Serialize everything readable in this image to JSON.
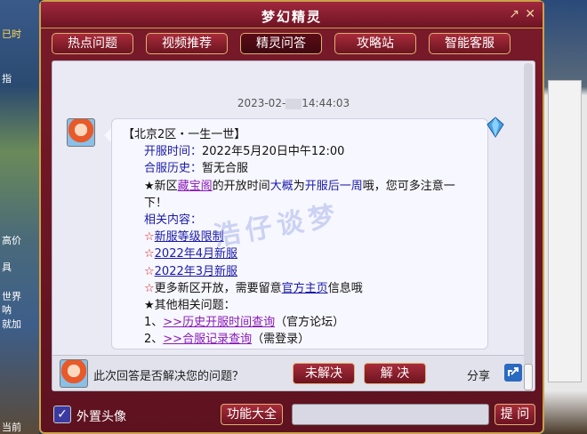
{
  "window": {
    "title": "梦幻精灵"
  },
  "nav": [
    "热点问题",
    "视频推荐",
    "精灵问答",
    "攻略站",
    "智能客服"
  ],
  "chat": {
    "timestamp_prefix": "2023-02-",
    "timestamp_suffix": "14:44:03",
    "answer": {
      "heading": "【北京2区・一生一世】",
      "open_label": "开服时间：",
      "open_value": "2022年5月20日中午12:00",
      "merge_label": "合服历史：",
      "merge_value": "暂无合服",
      "tip_a": "★新区",
      "tip_link": "藏宝阁",
      "tip_b": "的开放时间",
      "tip_c": "大概",
      "tip_d": "为",
      "tip_e": "开服后一周",
      "tip_f": "哦，您可多注意一下！",
      "related_label": "相关内容：",
      "related": [
        "新服等级限制",
        "2022年4月新服",
        "2022年3月新服"
      ],
      "more_a": "更多新区开放，需要留意",
      "more_link": "官方主页",
      "more_b": "信息哦",
      "other_label": "★其他相关问题：",
      "q1_num": "1、",
      "q1_link": ">>历史开服时间查询",
      "q1_note": "（官方论坛）",
      "q2_num": "2、",
      "q2_link": ">>合服记录查询",
      "q2_note": "（需登录）"
    },
    "watermark": "浩仔谈梦"
  },
  "feedback": {
    "question": "此次回答是否解决您的问题？",
    "unresolved": "未解决",
    "resolved": "解 决",
    "share": "分享"
  },
  "footer": {
    "checkbox_mark": "✓",
    "checkbox_label": "外置头像",
    "func_button": "功能大全",
    "ask_button": "提 问"
  },
  "background": {
    "left_labels": [
      "已时",
      "指",
      "高价",
      "具",
      "世界",
      "呐",
      "就加",
      "当前"
    ]
  }
}
